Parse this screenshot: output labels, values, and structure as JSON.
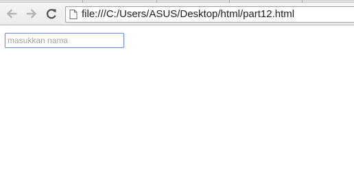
{
  "browser": {
    "address_bar": {
      "url": "file:///C:/Users/ASUS/Desktop/html/part12.html"
    },
    "icons": {
      "back": "back-arrow-icon",
      "forward": "forward-arrow-icon",
      "reload": "reload-icon",
      "page": "page-icon"
    }
  },
  "page": {
    "name_input": {
      "placeholder": "masukkan nama",
      "value": ""
    }
  },
  "colors": {
    "input_focus_border": "#6d90d9",
    "toolbar_bg": "#efefef"
  }
}
